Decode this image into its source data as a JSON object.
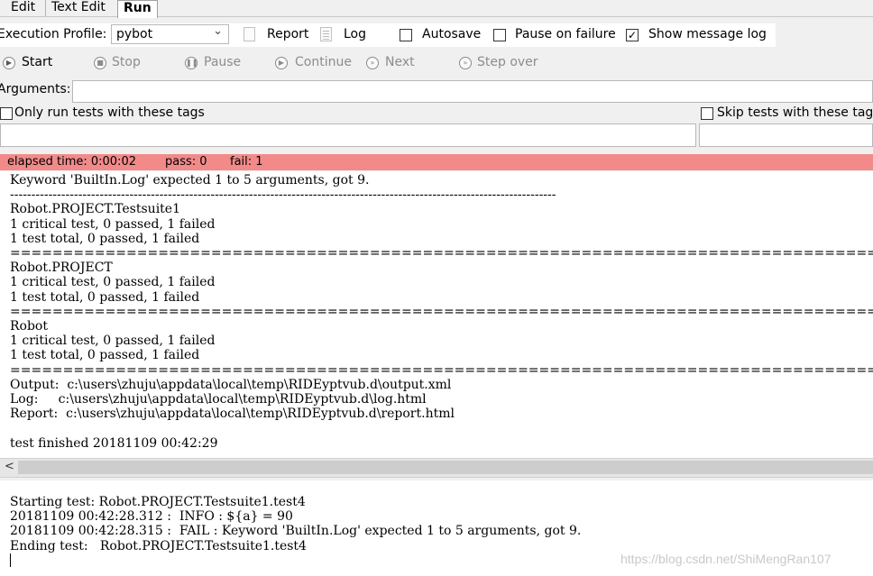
{
  "tabs": [
    {
      "label": "Edit"
    },
    {
      "label": "Text Edit"
    },
    {
      "label": "Run"
    }
  ],
  "toolbar": {
    "profile_label": "Execution Profile:",
    "profile_value": "pybot",
    "report_label": "Report",
    "log_label": "Log",
    "autosave_label": "Autosave",
    "autosave_checked": false,
    "pause_label": "Pause on failure",
    "pause_checked": false,
    "show_log_label": "Show message log",
    "show_log_checked": true
  },
  "controls": {
    "start": "Start",
    "stop": "Stop",
    "pause": "Pause",
    "continue": "Continue",
    "next": "Next",
    "step_over": "Step over"
  },
  "arguments": {
    "label": "Arguments:",
    "value": ""
  },
  "tags": {
    "include_label": "Only run tests with these tags",
    "include_value": "",
    "exclude_label": "Skip tests with these tag",
    "exclude_value": ""
  },
  "status": {
    "elapsed": "elapsed time: 0:00:02",
    "pass": "pass: 0",
    "fail": "fail: 1",
    "color": "#f28a8a"
  },
  "output_console": {
    "text": "Keyword 'BuiltIn.Log' expected 1 to 5 arguments, got 9.\n--------------------------------------------------------------------------------------------------------------------------------\nRobot.PROJECT.Testsuite1\n1 critical test, 0 passed, 1 failed\n1 test total, 0 passed, 1 failed\n================================================================================================================================\nRobot.PROJECT\n1 critical test, 0 passed, 1 failed\n1 test total, 0 passed, 1 failed\n================================================================================================================================\nRobot\n1 critical test, 0 passed, 1 failed\n1 test total, 0 passed, 1 failed\n================================================================================================================================\nOutput:  c:\\users\\zhuju\\appdata\\local\\temp\\RIDEyptvub.d\\output.xml\nLog:     c:\\users\\zhuju\\appdata\\local\\temp\\RIDEyptvub.d\\log.html\nReport:  c:\\users\\zhuju\\appdata\\local\\temp\\RIDEyptvub.d\\report.html\n\ntest finished 20181109 00:42:29"
  },
  "message_log": {
    "text": "Starting test: Robot.PROJECT.Testsuite1.test4\n20181109 00:42:28.312 :  INFO : ${a} = 90\n20181109 00:42:28.315 :  FAIL : Keyword 'BuiltIn.Log' expected 1 to 5 arguments, got 9.\nEnding test:   Robot.PROJECT.Testsuite1.test4"
  },
  "watermark": "https://blog.csdn.net/ShiMengRan107"
}
